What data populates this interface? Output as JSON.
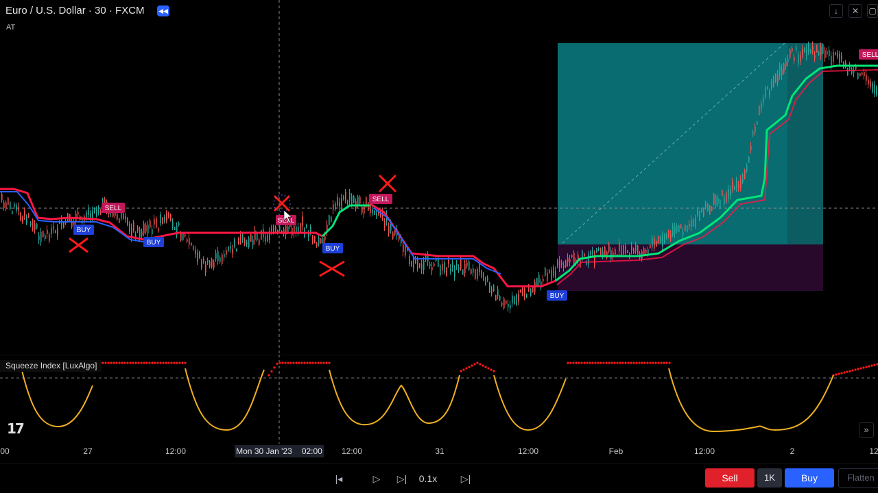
{
  "header": {
    "symbol_title": "Euro / U.S. Dollar · 30 · FXCM",
    "sub_label": "AT",
    "replay_icon": "rewind-icon",
    "window_controls": [
      "arrow-down-icon",
      "close-icon",
      "maximize-icon"
    ]
  },
  "indicator": {
    "label": "Squeeze Index [LuxAlgo]"
  },
  "time_axis": {
    "labels": [
      "00",
      "27",
      "12:00",
      "12:00",
      "31",
      "12:00",
      "Feb",
      "12:00",
      "2",
      "12"
    ],
    "cursor_date": "Mon 30 Jan '23",
    "cursor_time": "02:00"
  },
  "signals": {
    "sell_label": "SELL",
    "buy_label": "BUY"
  },
  "colors": {
    "background": "#000000",
    "bull_line": "#00e676",
    "bear_line": "#ff1744",
    "trend_blue": "#2962ff",
    "sell_badge": "#c2185b",
    "buy_badge": "#1e3fd8",
    "profit_zone": "#0a7f85",
    "loss_zone": "#2a0a2e",
    "squeeze_dots": "#ff1a1a",
    "squeeze_curve": "#f0b020"
  },
  "replay_controls": {
    "speed": "0.1x",
    "icons": [
      "jump-back-icon",
      "play-icon",
      "step-forward-icon",
      "jump-to-end-icon"
    ]
  },
  "trading": {
    "sell_label": "Sell",
    "quantity": "1K",
    "buy_label": "Buy",
    "flatten_label": "Flatten"
  },
  "logo": "tradingview-logo"
}
